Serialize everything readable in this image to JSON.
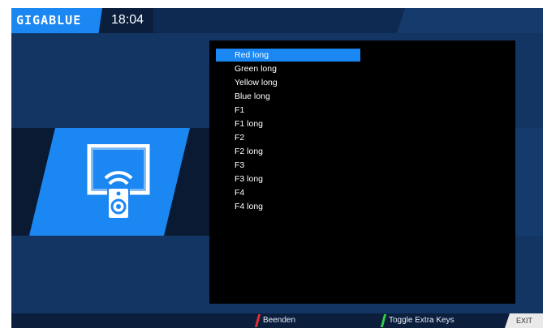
{
  "header": {
    "logo_text": "GIGABLUE",
    "clock": "18:04"
  },
  "sidebar_icon": "remote-control-icon",
  "list": {
    "items": [
      {
        "label": "Red long",
        "selected": true
      },
      {
        "label": "Green long",
        "selected": false
      },
      {
        "label": "Yellow long",
        "selected": false
      },
      {
        "label": "Blue long",
        "selected": false
      },
      {
        "label": "F1",
        "selected": false
      },
      {
        "label": "F1 long",
        "selected": false
      },
      {
        "label": "F2",
        "selected": false
      },
      {
        "label": "F2 long",
        "selected": false
      },
      {
        "label": "F3",
        "selected": false
      },
      {
        "label": "F3 long",
        "selected": false
      },
      {
        "label": "F4",
        "selected": false
      },
      {
        "label": "F4 long",
        "selected": false
      }
    ]
  },
  "footer": {
    "red_label": "Beenden",
    "green_label": "Toggle Extra Keys",
    "exit_label": "EXIT"
  },
  "colors": {
    "accent": "#1b87f2",
    "background": "#123563",
    "red_key": "#e03030",
    "green_key": "#2fd04a"
  }
}
